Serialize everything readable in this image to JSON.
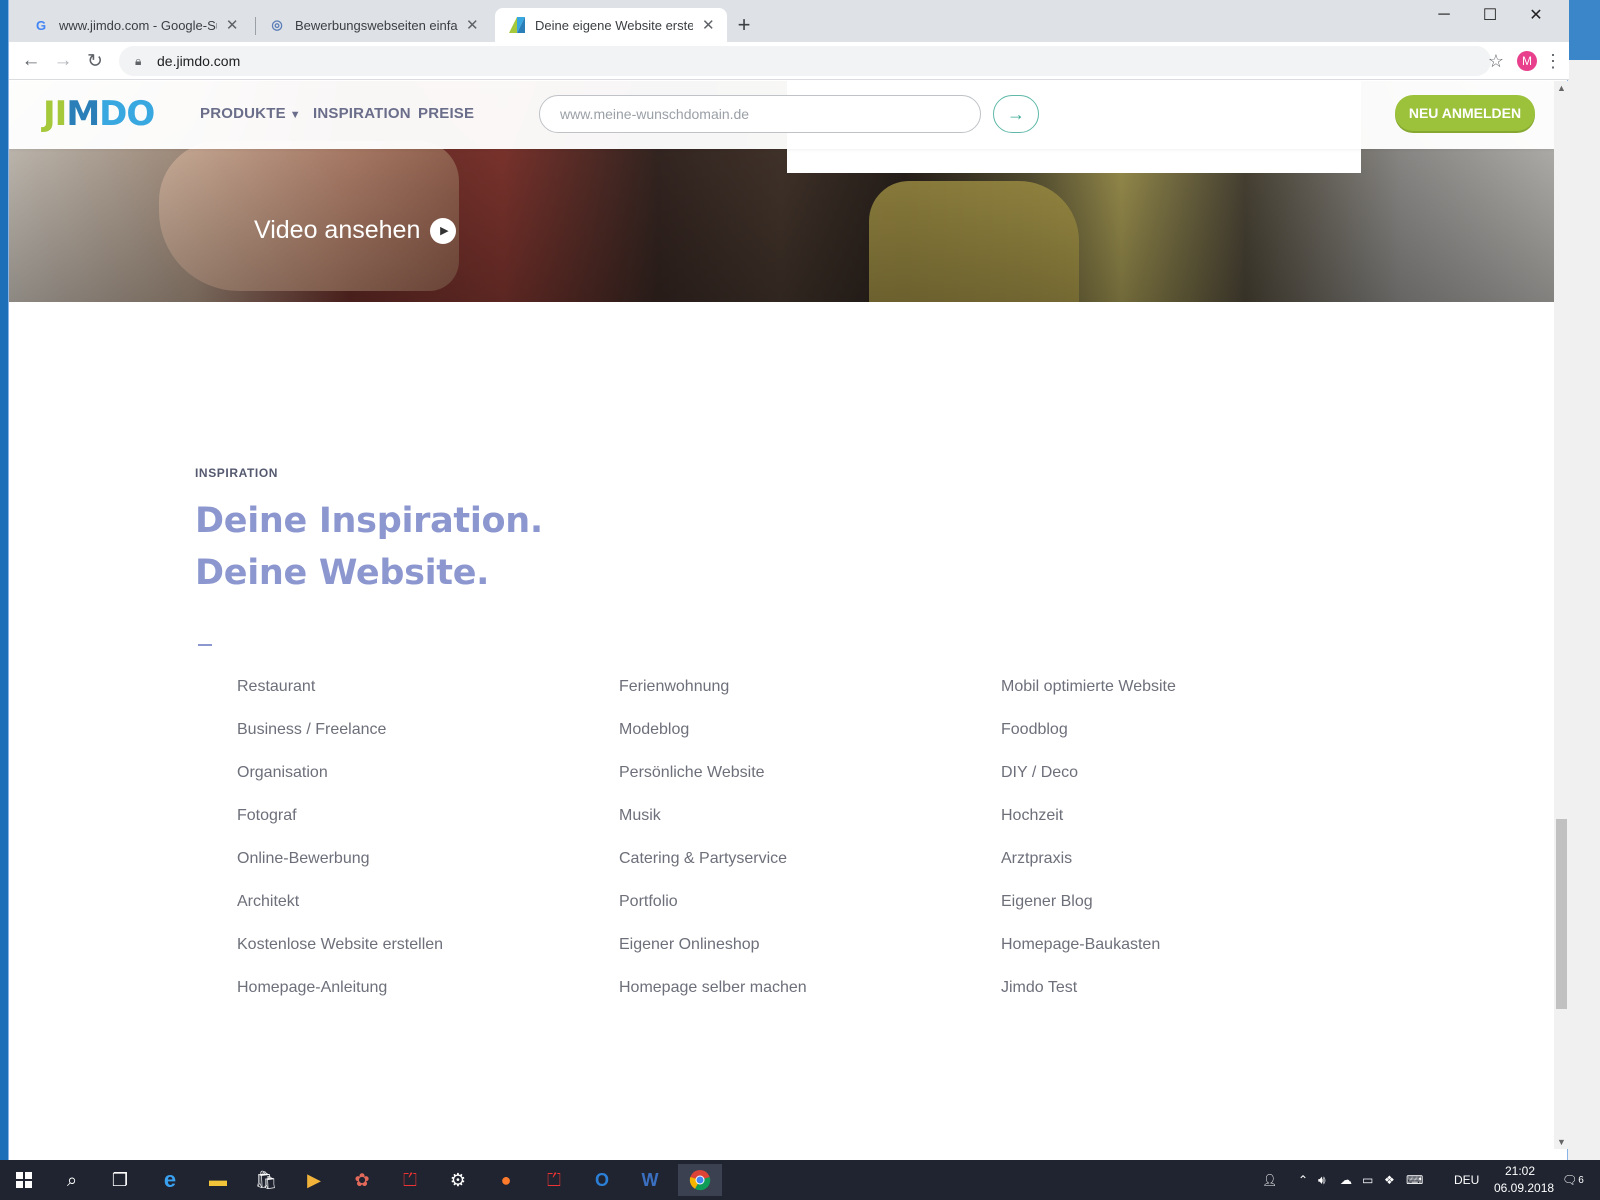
{
  "browser": {
    "tabs": [
      {
        "title": "www.jimdo.com - Google-Suche",
        "favicon": "google-icon",
        "active": false
      },
      {
        "title": "Bewerbungswebseiten einfach un",
        "favicon": "globe-icon",
        "active": false
      },
      {
        "title": "Deine eigene Website erstellen -",
        "favicon": "jimdo-icon",
        "active": true
      }
    ],
    "url": "de.jimdo.com",
    "profile_initial": "M"
  },
  "site": {
    "logo": "JIMDO",
    "nav": {
      "produkte": "PRODUKTE",
      "inspiration": "INSPIRATION",
      "preise": "PREISE"
    },
    "domain_placeholder": "www.meine-wunschdomain.de",
    "signup_label": "NEU ANMELDEN"
  },
  "hero": {
    "video_label": "Video ansehen"
  },
  "inspiration": {
    "eyebrow": "INSPIRATION",
    "headline_line1": "Deine Inspiration.",
    "headline_line2": "Deine Website.",
    "columns": [
      [
        "Restaurant",
        "Business / Freelance",
        "Organisation",
        "Fotograf",
        "Online-Bewerbung",
        "Architekt",
        "Kostenlose Website erstellen",
        "Homepage-Anleitung"
      ],
      [
        "Ferienwohnung",
        "Modeblog",
        "Persönliche Website",
        "Musik",
        "Catering & Partyservice",
        "Portfolio",
        "Eigener Onlineshop",
        "Homepage selber machen"
      ],
      [
        "Mobil optimierte Website",
        "Foodblog",
        "DIY / Deco",
        "Hochzeit",
        "Arztpraxis",
        "Eigener Blog",
        "Homepage-Baukasten",
        "Jimdo Test"
      ]
    ]
  },
  "taskbar": {
    "language": "DEU",
    "time": "21:02",
    "date": "06.09.2018",
    "notifications": "6"
  },
  "colors": {
    "jimdo_green": "#9cc23c",
    "jimdo_blue": "#3aa8e0",
    "headline": "#8c97cf"
  }
}
